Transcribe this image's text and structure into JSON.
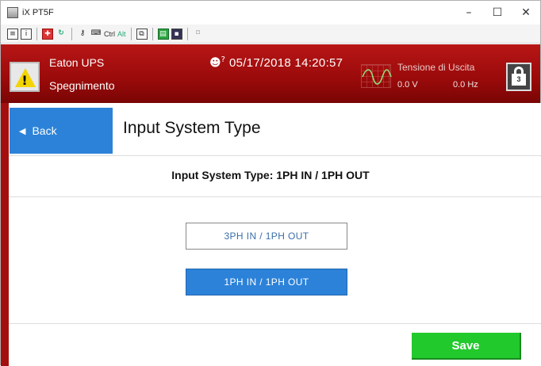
{
  "window": {
    "title": "iX PT5F",
    "minimize": "–",
    "maximize": "☐",
    "close": "✕"
  },
  "toolbar": {
    "icons": [
      "properties-icon",
      "info-icon",
      "network-icon",
      "refresh-icon",
      "keys-icon",
      "printer-icon"
    ],
    "ctrl_label": "Ctrl",
    "alt_label": "Alt"
  },
  "header": {
    "device_name": "Eaton UPS",
    "device_status": "Spegnimento",
    "datetime": "05/17/2018 14:20:57",
    "alarm_badge": "?",
    "output_label": "Tensione di Uscita",
    "output_voltage": "0.0 V",
    "output_frequency": "0.0 Hz",
    "lock_number": "3",
    "colors": {
      "header_red": "#9a0a0a",
      "warning_yellow": "#f4d400"
    }
  },
  "page": {
    "back_label": "Back",
    "title": "Input System Type",
    "info_text": "Input System Type: 1PH IN / 1PH OUT",
    "options": [
      {
        "label": "3PH IN / 1PH OUT",
        "selected": false
      },
      {
        "label": "1PH IN / 1PH OUT",
        "selected": true
      }
    ],
    "save_label": "Save",
    "colors": {
      "accent_blue": "#2c82d8",
      "save_green": "#22c92d"
    }
  }
}
